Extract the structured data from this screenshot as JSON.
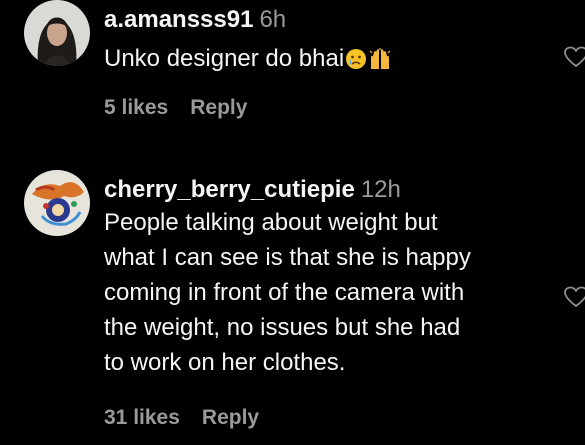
{
  "comments": [
    {
      "username": "a.amansss91",
      "time": "6h",
      "text": "Unko designer do bhai",
      "emoji_icons": [
        "crying-face-icon",
        "raising-hands-icon"
      ],
      "likes": "5 likes",
      "reply_label": "Reply",
      "like_icon": "heart-outline-icon"
    },
    {
      "username": "cherry_berry_cutiepie",
      "time": "12h",
      "text_lines": [
        "People talking about weight but",
        "what I can see is that she is happy",
        "coming in front of the camera with",
        "the weight, no issues but she had",
        "to work on her clothes."
      ],
      "likes": "31 likes",
      "reply_label": "Reply",
      "like_icon": "heart-outline-icon"
    }
  ],
  "colors": {
    "background": "#000000",
    "primary_text": "#f5f5f5",
    "secondary_text": "#9a9a9a"
  }
}
